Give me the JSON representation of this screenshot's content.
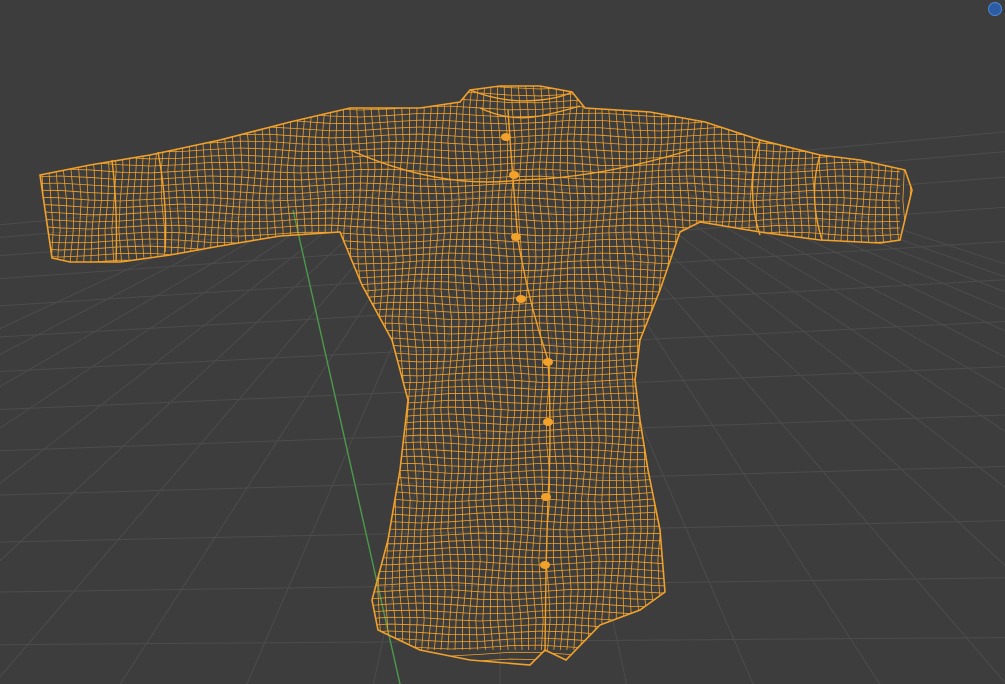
{
  "viewport": {
    "mode": "wireframe",
    "background_color": "#3d3d3d",
    "grid_color": "#4c4c4c",
    "y_axis_color": "#4b9a4b"
  },
  "object": {
    "type": "shirt-mesh",
    "selected": true,
    "wire_color": "#f2a12a"
  },
  "gizmo": {
    "icon": "view-gizmo-icon",
    "color": "#4a86d6"
  }
}
